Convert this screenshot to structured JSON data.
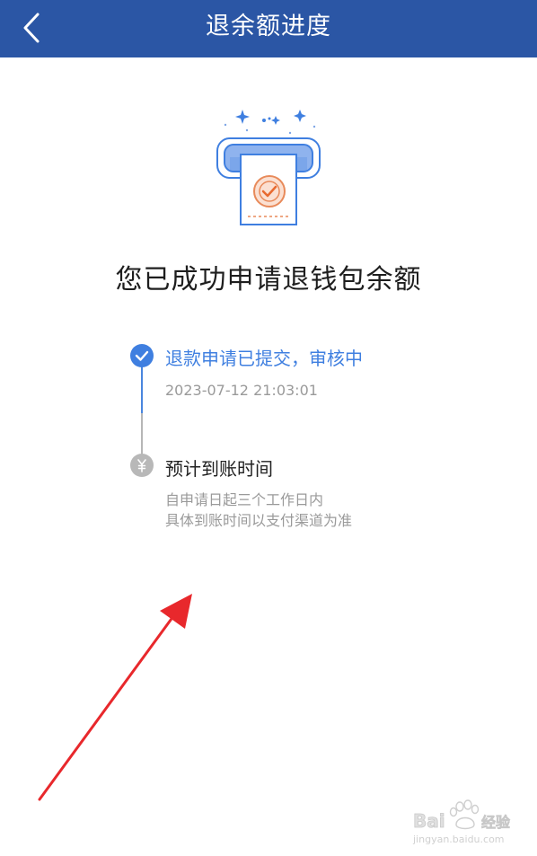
{
  "navbar": {
    "title": "退余额进度",
    "back_icon": "chevron-left-icon"
  },
  "hero": {
    "icon": "receipt-check-illustration"
  },
  "headline": "您已成功申请退钱包余额",
  "timeline": {
    "steps": [
      {
        "title": "退款申请已提交，审核中",
        "time": "2023-07-12 21:03:01",
        "status": "done"
      },
      {
        "title": "预计到账时间",
        "desc_line1": "自申请日起三个工作日内",
        "desc_line2": "具体到账时间以支付渠道为准",
        "status": "pending"
      }
    ]
  },
  "colors": {
    "nav_bg": "#2b56a5",
    "accent": "#3f7fe0",
    "pending": "#b8b8b8",
    "annotation": "#e8282c"
  },
  "watermark": {
    "brand": "Bai",
    "brand_suffix": "经验",
    "url": "jingyan.baidu.com"
  }
}
